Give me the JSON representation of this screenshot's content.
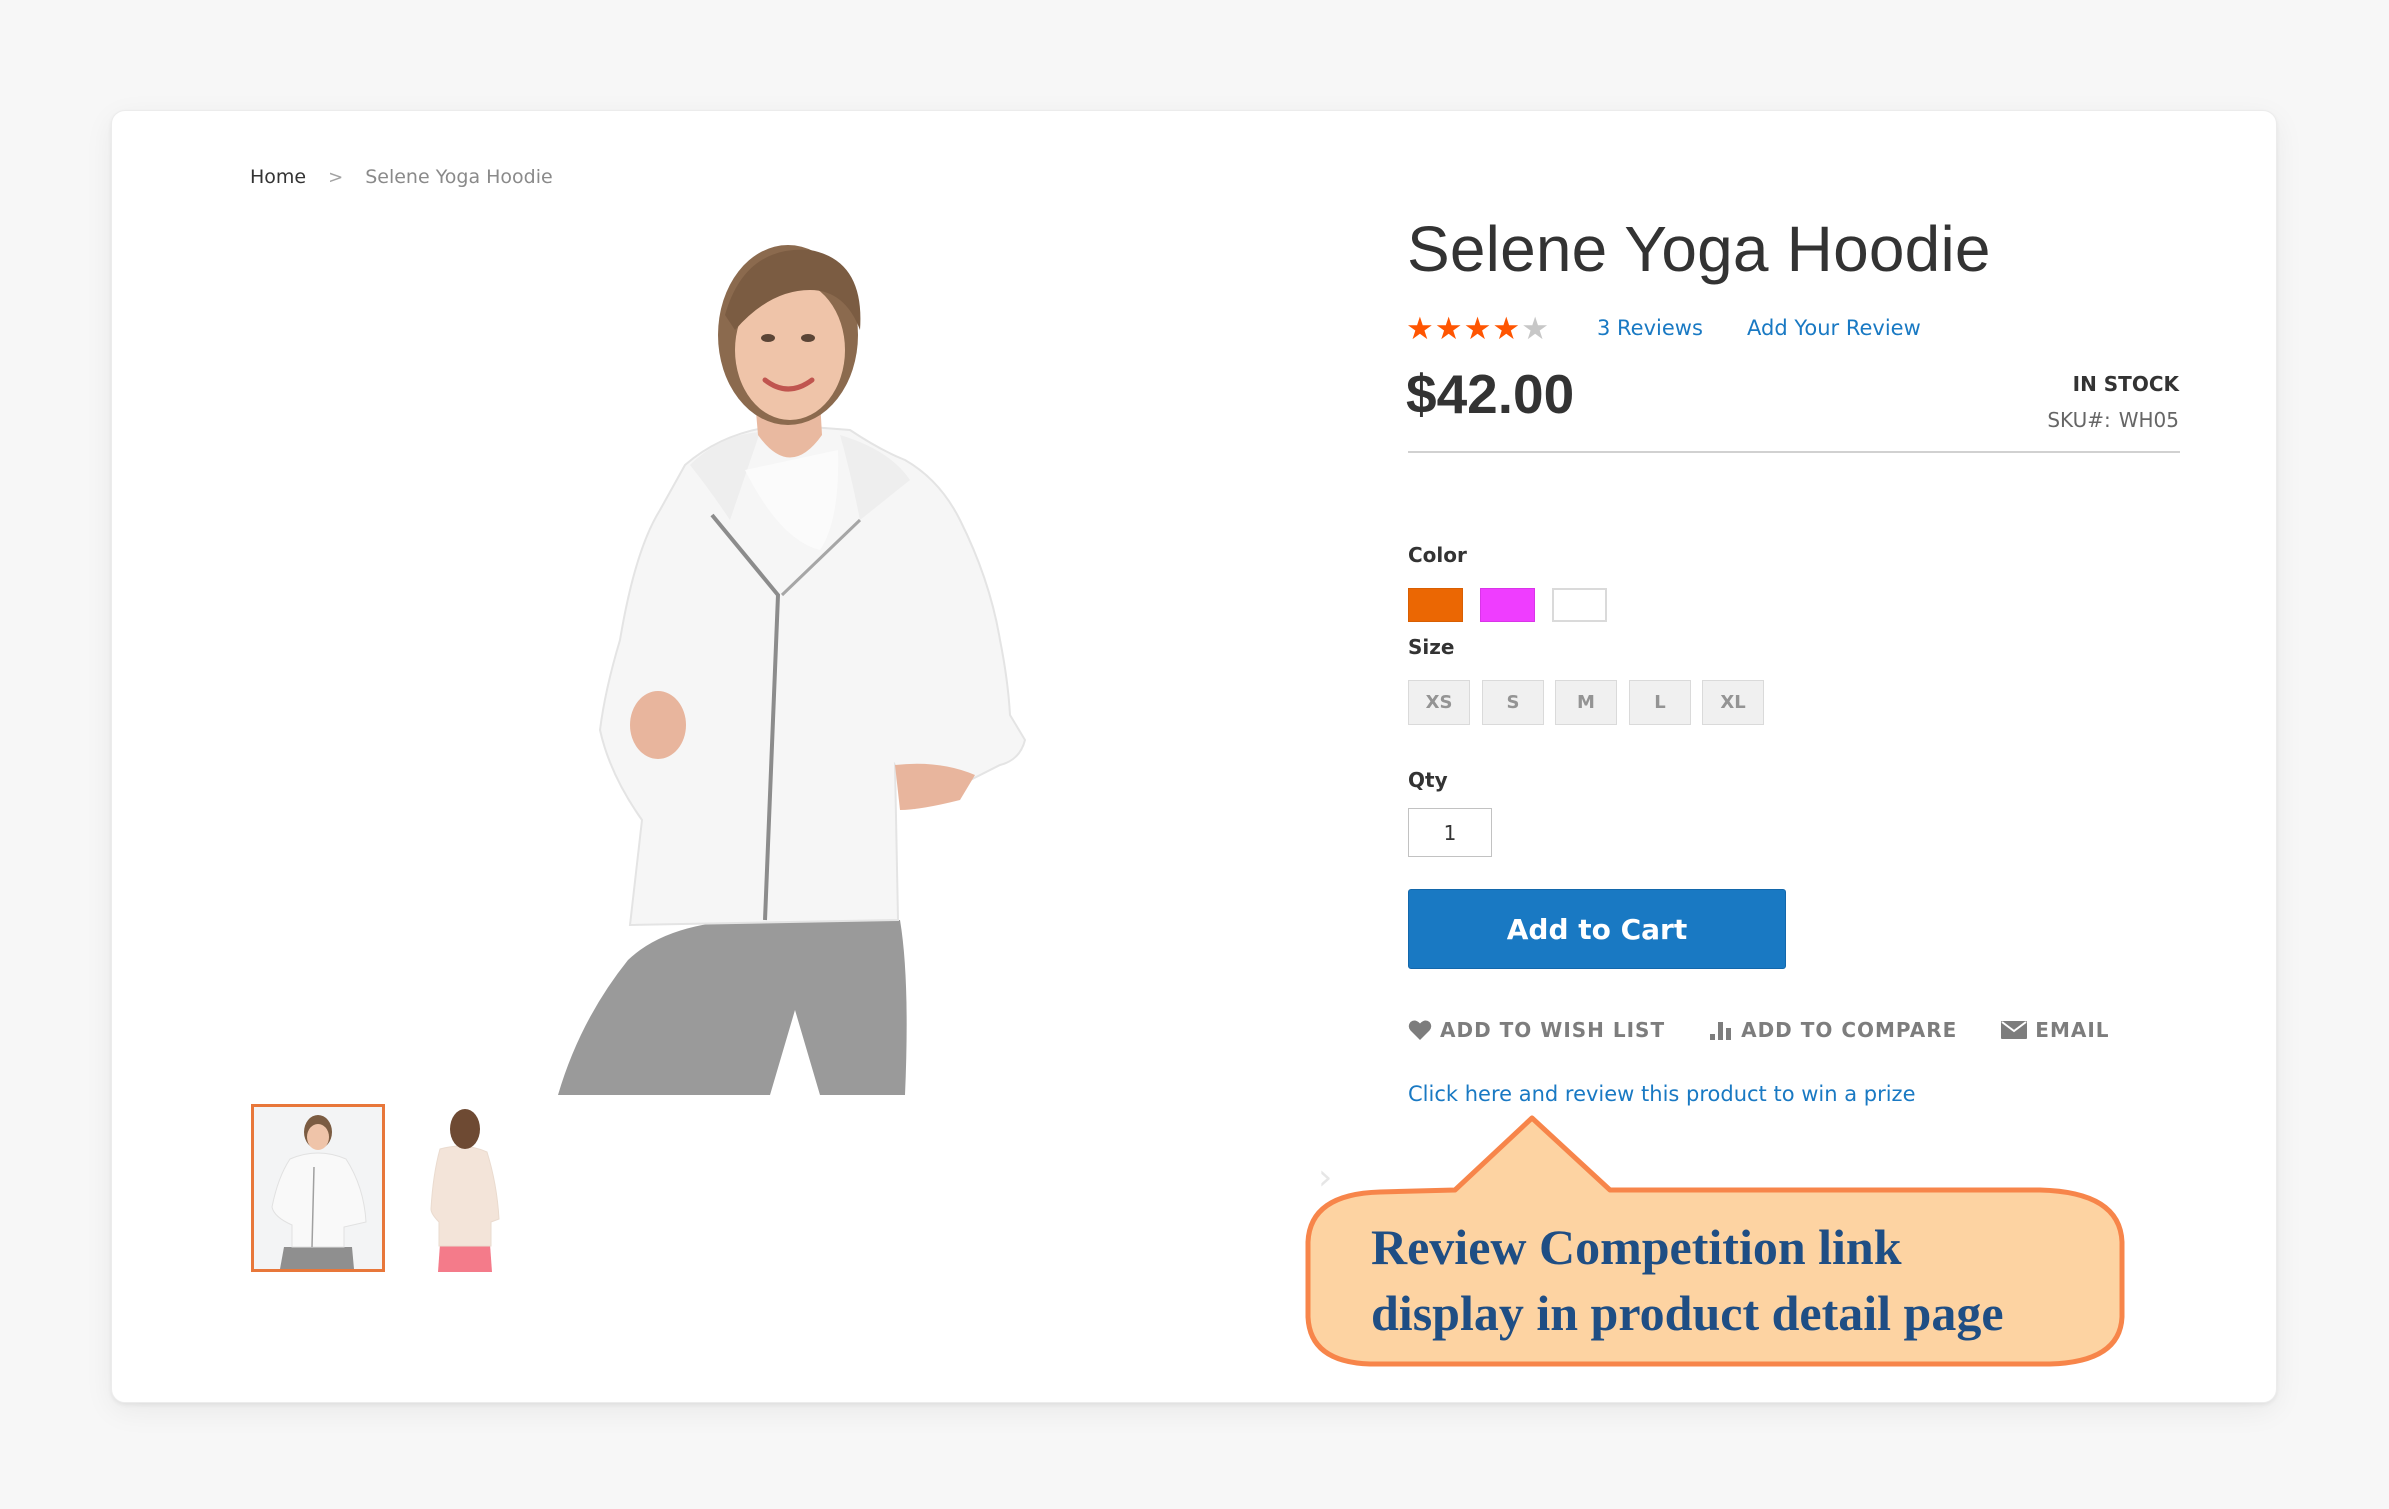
{
  "breadcrumb": {
    "home": "Home",
    "separator": ">",
    "current": "Selene Yoga Hoodie"
  },
  "product": {
    "title": "Selene Yoga Hoodie",
    "rating": {
      "value": 4,
      "max": 5
    },
    "reviews_link": "3 Reviews",
    "add_review_link": "Add Your Review",
    "price": "$42.00",
    "stock_status": "IN STOCK",
    "sku_label": "SKU#:",
    "sku_value": "WH05"
  },
  "options": {
    "color_label": "Color",
    "colors": [
      {
        "name": "Orange",
        "hex": "#eb6703"
      },
      {
        "name": "Purple",
        "hex": "#ef3dff"
      },
      {
        "name": "White",
        "hex": "#ffffff"
      }
    ],
    "size_label": "Size",
    "sizes": [
      "XS",
      "S",
      "M",
      "L",
      "XL"
    ]
  },
  "qty": {
    "label": "Qty",
    "value": "1"
  },
  "add_to_cart_label": "Add to Cart",
  "actions": {
    "wish_list": "ADD TO WISH LIST",
    "compare": "ADD TO COMPARE",
    "email": "EMAIL"
  },
  "review_prize_link": "Click here and review this product to win a prize",
  "callout": {
    "line1": "Review Competition link",
    "line2": "display in product detail page"
  },
  "colors": {
    "accent_blue": "#1979c3",
    "star_on": "#ff5501",
    "star_off": "#c7c7c7",
    "thumb_active_border": "#e8773a",
    "callout_fill": "#fdd3a2",
    "callout_border": "#f7854a",
    "callout_text": "#1f4e84"
  }
}
